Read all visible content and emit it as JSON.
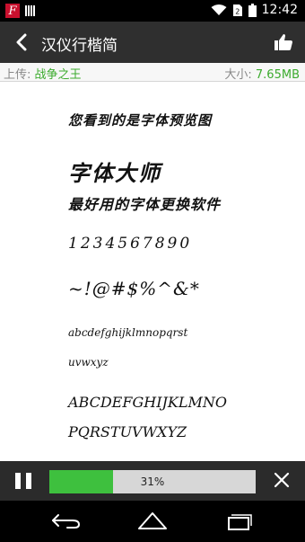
{
  "status_bar": {
    "time": "12:42",
    "app_icon_letter": "F",
    "icons": [
      "app-icon",
      "signal-bars-icon",
      "wifi-icon",
      "sim-icon",
      "battery-icon"
    ]
  },
  "header": {
    "title": "汉仪行楷简",
    "back_icon": "back-arrow-icon",
    "like_icon": "thumbs-up-icon"
  },
  "info": {
    "uploader_label": "上传:",
    "uploader_value": "战争之王",
    "size_label": "大小:",
    "size_value": "7.65MB"
  },
  "preview": {
    "line1": "您看到的是字体预览图",
    "line2": "字体大师",
    "line3": "最好用的字体更换软件",
    "line4": "1234567890",
    "line5": "~!@#$%^&*",
    "line6": "abcdefghijklmnopqrst",
    "line7": "uvwxyz",
    "line8": "ABCDEFGHIJKLMNO",
    "line9": "PQRSTUVWXYZ"
  },
  "download": {
    "progress": 0.31,
    "progress_text": "31%",
    "pause_icon": "pause-icon",
    "cancel_icon": "close-icon"
  },
  "colors": {
    "accent_green": "#3cab2e",
    "progress_fill": "#3ec03e",
    "titlebar_bg": "#2f2f2f"
  },
  "nav_bar": {
    "icons": [
      "back-nav-icon",
      "home-nav-icon",
      "recents-nav-icon"
    ]
  }
}
